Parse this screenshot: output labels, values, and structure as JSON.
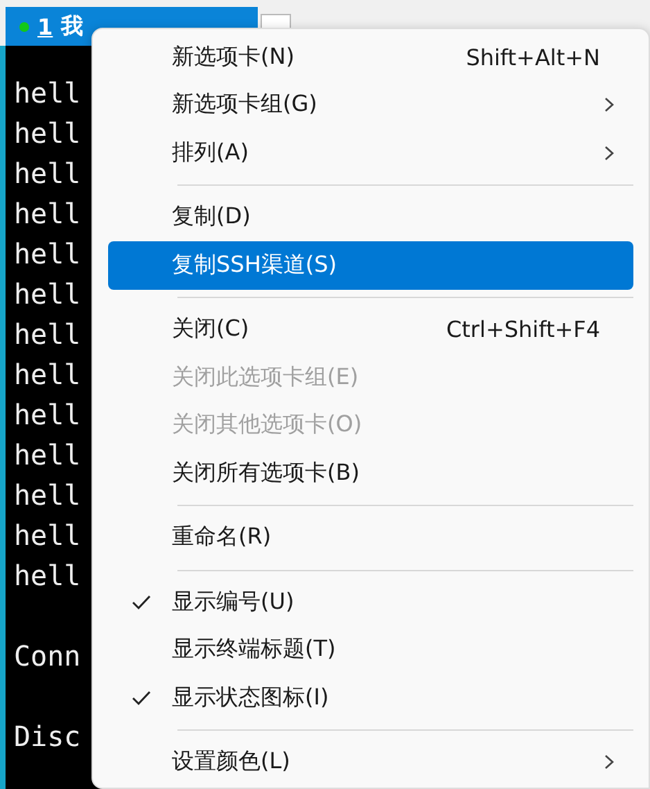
{
  "tab": {
    "number": "1",
    "title": "我",
    "selected": true
  },
  "terminal": {
    "lines": [
      "hell",
      "hell",
      "hell",
      "hell",
      "hell",
      "hell",
      "hell",
      "hell",
      "hell",
      "hell",
      "hell",
      "hell",
      "hell"
    ],
    "messages": [
      "Conn",
      "Disc"
    ]
  },
  "context_menu": {
    "items": [
      {
        "kind": "item",
        "label": "新选项卡(N)",
        "shortcut": "Shift+Alt+N",
        "submenu": false,
        "disabled": false,
        "checked": false,
        "selected": false
      },
      {
        "kind": "item",
        "label": "新选项卡组(G)",
        "submenu": true,
        "disabled": false,
        "checked": false,
        "selected": false
      },
      {
        "kind": "item",
        "label": "排列(A)",
        "submenu": true,
        "disabled": false,
        "checked": false,
        "selected": false
      },
      {
        "kind": "separator"
      },
      {
        "kind": "item",
        "label": "复制(D)",
        "submenu": false,
        "disabled": false,
        "checked": false,
        "selected": false
      },
      {
        "kind": "item",
        "label": "复制SSH渠道(S)",
        "submenu": false,
        "disabled": false,
        "checked": false,
        "selected": true
      },
      {
        "kind": "separator"
      },
      {
        "kind": "item",
        "label": "关闭(C)",
        "shortcut": "Ctrl+Shift+F4",
        "submenu": false,
        "disabled": false,
        "checked": false,
        "selected": false
      },
      {
        "kind": "item",
        "label": "关闭此选项卡组(E)",
        "submenu": false,
        "disabled": true,
        "checked": false,
        "selected": false
      },
      {
        "kind": "item",
        "label": "关闭其他选项卡(O)",
        "submenu": false,
        "disabled": true,
        "checked": false,
        "selected": false
      },
      {
        "kind": "item",
        "label": "关闭所有选项卡(B)",
        "submenu": false,
        "disabled": false,
        "checked": false,
        "selected": false
      },
      {
        "kind": "separator"
      },
      {
        "kind": "item",
        "label": "重命名(R)",
        "submenu": false,
        "disabled": false,
        "checked": false,
        "selected": false
      },
      {
        "kind": "separator"
      },
      {
        "kind": "item",
        "label": "显示编号(U)",
        "submenu": false,
        "disabled": false,
        "checked": true,
        "selected": false
      },
      {
        "kind": "item",
        "label": "显示终端标题(T)",
        "submenu": false,
        "disabled": false,
        "checked": false,
        "selected": false
      },
      {
        "kind": "item",
        "label": "显示状态图标(I)",
        "submenu": false,
        "disabled": false,
        "checked": true,
        "selected": false
      },
      {
        "kind": "separator"
      },
      {
        "kind": "item",
        "label": "设置颜色(L)",
        "submenu": true,
        "disabled": false,
        "checked": false,
        "selected": false
      }
    ]
  }
}
